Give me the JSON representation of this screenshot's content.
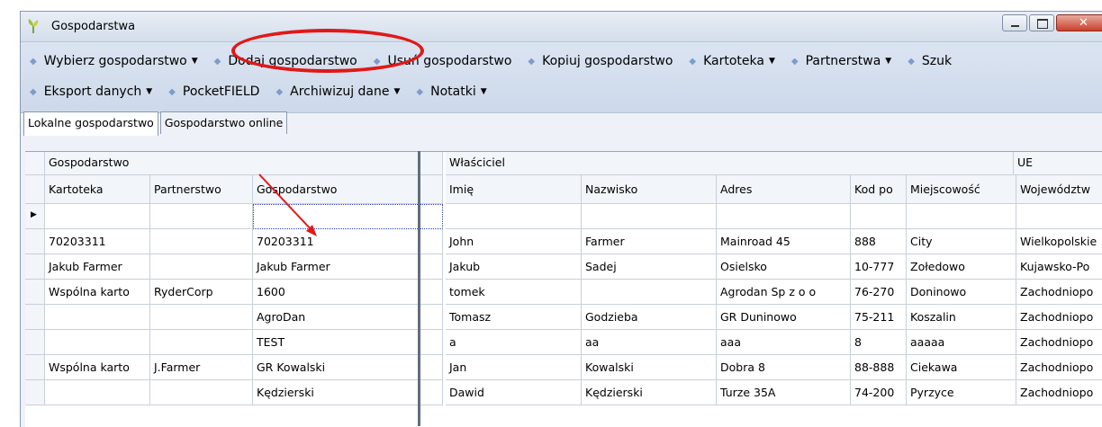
{
  "window": {
    "title": "Gospodarstwa"
  },
  "toolbar": {
    "row1": [
      {
        "label": "Wybierz gospodarstwo",
        "dropdown": true
      },
      {
        "label": "Dodaj gospodarstwo",
        "dropdown": false
      },
      {
        "label": "Usuń gospodarstwo",
        "dropdown": false
      },
      {
        "label": "Kopiuj gospodarstwo",
        "dropdown": false
      },
      {
        "label": "Kartoteka",
        "dropdown": true
      },
      {
        "label": "Partnerstwa",
        "dropdown": true
      },
      {
        "label": "Szuk",
        "dropdown": false
      }
    ],
    "row2": [
      {
        "label": "Eksport danych",
        "dropdown": true
      },
      {
        "label": "PocketFIELD",
        "dropdown": false
      },
      {
        "label": "Archiwizuj dane",
        "dropdown": true
      },
      {
        "label": "Notatki",
        "dropdown": true
      }
    ]
  },
  "tabs": [
    {
      "label": "Lokalne gospodarstwo",
      "active": true
    },
    {
      "label": "Gospodarstwo online",
      "active": false
    }
  ],
  "grid": {
    "groups": [
      "Gospodarstwo",
      "Właściciel",
      "UE"
    ],
    "columns": [
      "Kartoteka",
      "Partnerstwo",
      "Gospodarstwo",
      "Imię",
      "Nazwisko",
      "Adres",
      "Kod po",
      "Miejscowość",
      "Województw"
    ],
    "rows": [
      [
        "",
        "",
        "",
        "",
        "",
        "",
        "",
        "",
        ""
      ],
      [
        "70203311",
        "",
        "70203311",
        "John",
        "Farmer",
        "Mainroad 45",
        "888",
        "City",
        "Wielkopolskie"
      ],
      [
        "Jakub Farmer",
        "",
        "Jakub Farmer",
        "Jakub",
        "Sadej",
        "Osielsko",
        "10-777",
        "Zołedowo",
        "Kujawsko-Po"
      ],
      [
        "Wspólna karto",
        "RyderCorp",
        "1600",
        "tomek",
        "",
        "Agrodan Sp z o o",
        "76-270",
        "Doninowo",
        "Zachodniopo"
      ],
      [
        "",
        "",
        "AgroDan",
        "Tomasz",
        "Godzieba",
        "GR Duninowo",
        "75-211",
        "Koszalin",
        "Zachodniopo"
      ],
      [
        "",
        "",
        "TEST",
        "a",
        "aa",
        "aaa",
        "8",
        "aaaaa",
        "Zachodniopo"
      ],
      [
        "Wspólna karto",
        "J.Farmer",
        "GR Kowalski",
        "Jan",
        "Kowalski",
        "Dobra 8",
        "88-888",
        "Ciekawa",
        "Zachodniopo"
      ],
      [
        "",
        "",
        "Kędzierski",
        "Dawid",
        "Kędzierski",
        "Turze 35A",
        "74-200",
        "Pyrzyce",
        "Zachodniopo"
      ]
    ]
  },
  "colors": {
    "highlight_ellipse": "#e01818",
    "arrow": "#e01818"
  }
}
